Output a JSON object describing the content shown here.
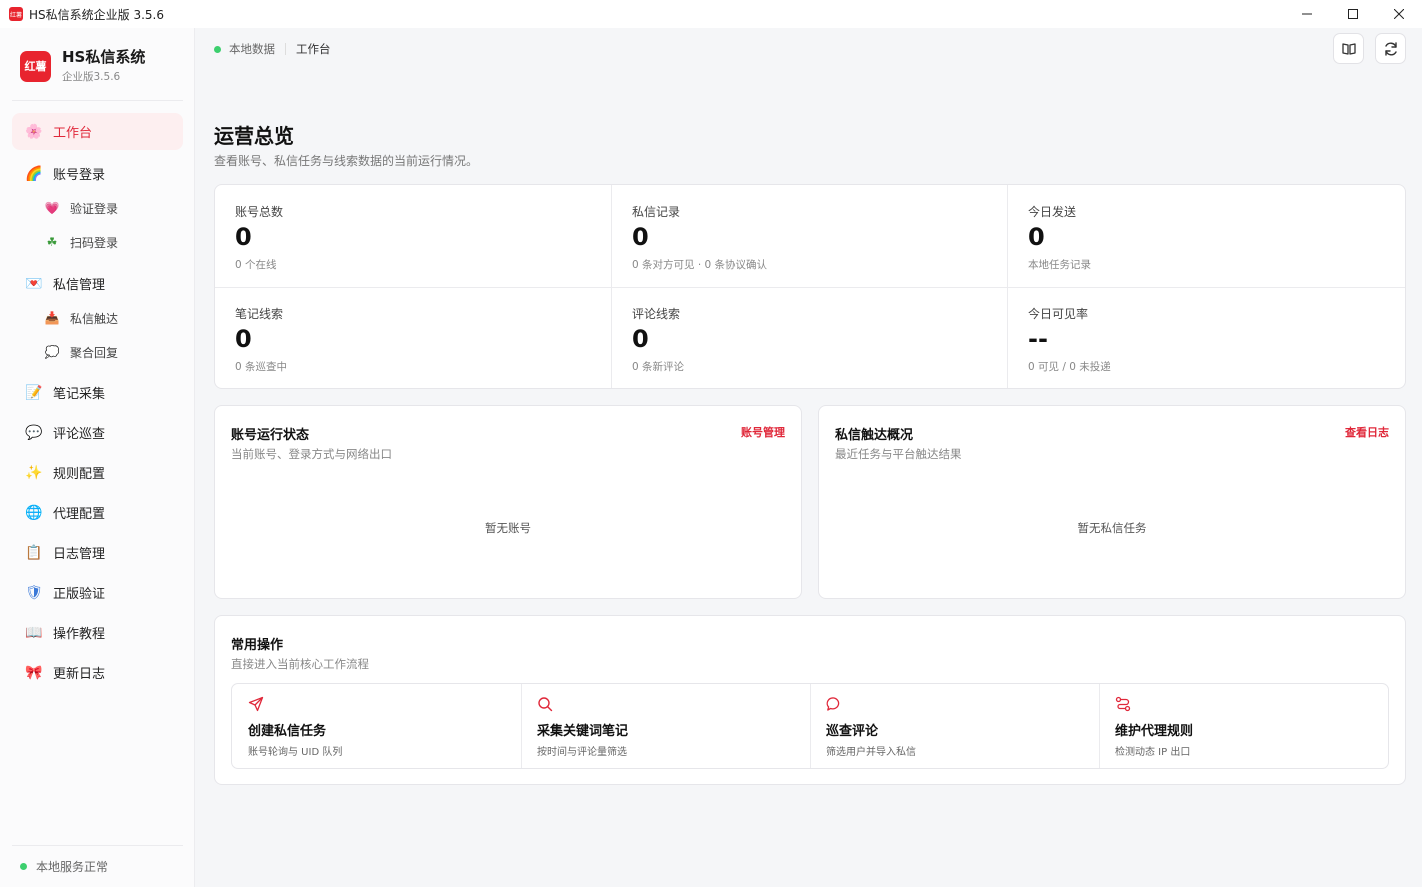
{
  "window": {
    "title": "HS私信系统企业版 3.5.6",
    "app_icon_text": "红薯"
  },
  "sidebar": {
    "brand_logo": "红薯",
    "brand_name": "HS私信系统",
    "brand_version": "企业版3.5.6",
    "items": [
      {
        "label": "工作台",
        "icon": "flower-icon",
        "glyph": "🌸"
      },
      {
        "label": "账号登录",
        "icon": "rainbow-icon",
        "glyph": "🌈"
      },
      {
        "label": "验证登录",
        "icon": "heart-icon",
        "glyph": "💗"
      },
      {
        "label": "扫码登录",
        "icon": "clover-icon",
        "glyph": "☘"
      },
      {
        "label": "私信管理",
        "icon": "love-letter-icon",
        "glyph": "💌"
      },
      {
        "label": "私信触达",
        "icon": "inbox-icon",
        "glyph": "📥"
      },
      {
        "label": "聚合回复",
        "icon": "speech-bubble-icon",
        "glyph": "💭"
      },
      {
        "label": "笔记采集",
        "icon": "memo-icon",
        "glyph": "📝"
      },
      {
        "label": "评论巡查",
        "icon": "chat-icon",
        "glyph": "💬"
      },
      {
        "label": "规则配置",
        "icon": "sparkles-icon",
        "glyph": "✨"
      },
      {
        "label": "代理配置",
        "icon": "globe-icon",
        "glyph": "🌐"
      },
      {
        "label": "日志管理",
        "icon": "clipboard-icon",
        "glyph": "📋"
      },
      {
        "label": "正版验证",
        "icon": "shield-icon",
        "glyph": "🛡"
      },
      {
        "label": "操作教程",
        "icon": "book-icon",
        "glyph": "📖"
      },
      {
        "label": "更新日志",
        "icon": "ribbon-icon",
        "glyph": "🎀"
      }
    ],
    "footer_status": "本地服务正常"
  },
  "header": {
    "breadcrumb_source": "本地数据",
    "breadcrumb_current": "工作台"
  },
  "overview": {
    "title": "运营总览",
    "subtitle": "查看账号、私信任务与线索数据的当前运行情况。",
    "stats": [
      {
        "label": "账号总数",
        "value": "0",
        "note": "0 个在线"
      },
      {
        "label": "私信记录",
        "value": "0",
        "note": "0 条对方可见 · 0 条协议确认"
      },
      {
        "label": "今日发送",
        "value": "0",
        "note": "本地任务记录"
      },
      {
        "label": "笔记线索",
        "value": "0",
        "note": "0 条巡查中"
      },
      {
        "label": "评论线索",
        "value": "0",
        "note": "0 条新评论"
      },
      {
        "label": "今日可见率",
        "value": "--",
        "note": "0 可见 / 0 未投递"
      }
    ]
  },
  "account_panel": {
    "title": "账号运行状态",
    "subtitle": "当前账号、登录方式与网络出口",
    "link": "账号管理",
    "empty": "暂无账号"
  },
  "dm_panel": {
    "title": "私信触达概况",
    "subtitle": "最近任务与平台触达结果",
    "link": "查看日志",
    "empty": "暂无私信任务"
  },
  "quick_ops": {
    "title": "常用操作",
    "subtitle": "直接进入当前核心工作流程",
    "items": [
      {
        "title": "创建私信任务",
        "desc": "账号轮询与 UID 队列",
        "icon": "send-icon"
      },
      {
        "title": "采集关键词笔记",
        "desc": "按时间与评论量筛选",
        "icon": "search-icon"
      },
      {
        "title": "巡查评论",
        "desc": "筛选用户并导入私信",
        "icon": "comment-icon"
      },
      {
        "title": "维护代理规则",
        "desc": "检测动态 IP 出口",
        "icon": "route-icon"
      }
    ]
  },
  "colors": {
    "accent": "#e0283a",
    "brand": "#e8242e",
    "status_ok": "#3ccf6e"
  }
}
